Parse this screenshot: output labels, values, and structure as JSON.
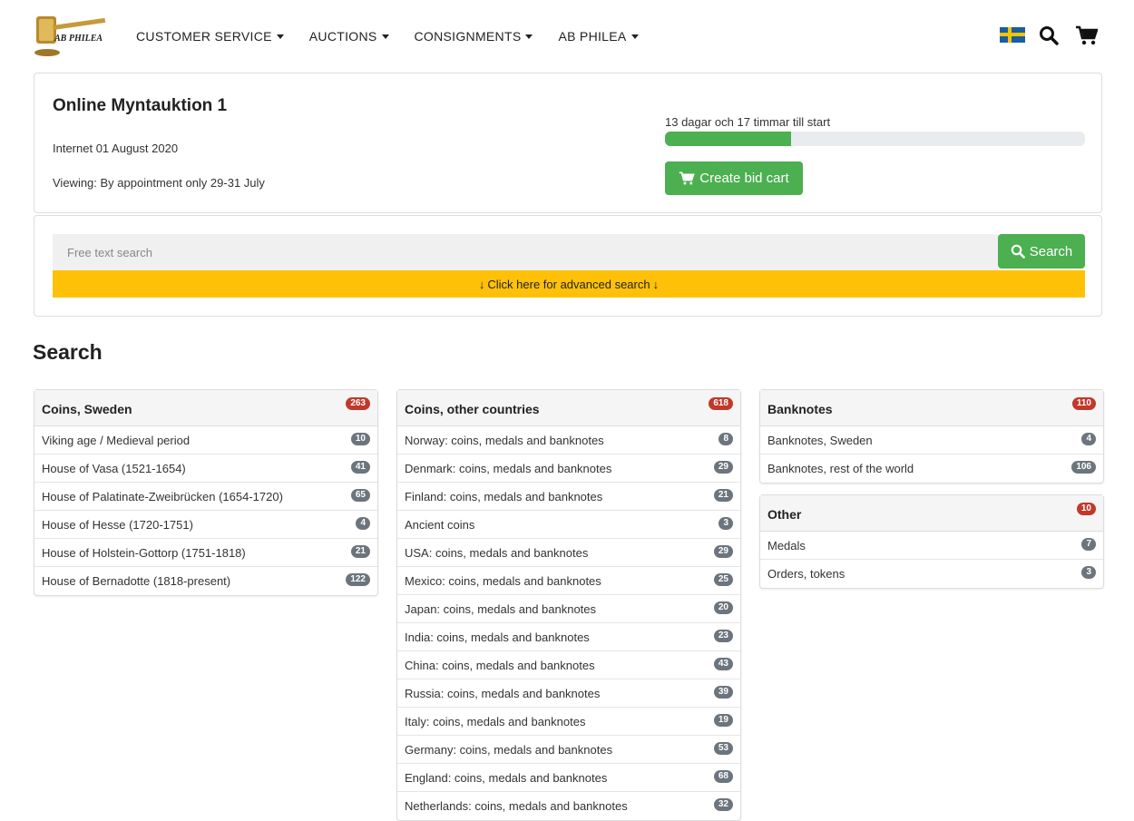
{
  "brand": {
    "logo_text": "AB PHILEA"
  },
  "nav": [
    {
      "label": "CUSTOMER SERVICE"
    },
    {
      "label": "AUCTIONS"
    },
    {
      "label": "CONSIGNMENTS"
    },
    {
      "label": "AB PHILEA"
    }
  ],
  "auction": {
    "title": "Online Myntauktion 1",
    "date": "Internet 01 August 2020",
    "viewing": "Viewing: By appointment only 29-31 July",
    "countdown": "13 dagar och 17 timmar till start",
    "progress_fraction": 0.3,
    "bid_cart_label": "Create bid cart"
  },
  "search": {
    "placeholder": "Free text search",
    "button_label": "Search",
    "advanced_label": "Click here for advanced search"
  },
  "section_title": "Search",
  "colors": {
    "green": "#4caf50",
    "yellow": "#ffc107",
    "badge_red": "#c0392b",
    "badge_gray": "#6c757d"
  },
  "categories": {
    "coins_sweden": {
      "title": "Coins, Sweden",
      "count": "263",
      "items": [
        {
          "label": "Viking age / Medieval period",
          "count": "10"
        },
        {
          "label": "House of Vasa (1521-1654)",
          "count": "41"
        },
        {
          "label": "House of Palatinate-Zweibrücken (1654-1720)",
          "count": "65"
        },
        {
          "label": "House of Hesse (1720-1751)",
          "count": "4"
        },
        {
          "label": "House of Holstein-Gottorp (1751-1818)",
          "count": "21"
        },
        {
          "label": "House of Bernadotte (1818-present)",
          "count": "122"
        }
      ]
    },
    "coins_other": {
      "title": "Coins, other countries",
      "count": "618",
      "items": [
        {
          "label": "Norway: coins, medals and banknotes",
          "count": "8"
        },
        {
          "label": "Denmark: coins, medals and banknotes",
          "count": "29"
        },
        {
          "label": "Finland: coins, medals and banknotes",
          "count": "21"
        },
        {
          "label": "Ancient coins",
          "count": "3"
        },
        {
          "label": "USA: coins, medals and banknotes",
          "count": "29"
        },
        {
          "label": "Mexico: coins, medals and banknotes",
          "count": "25"
        },
        {
          "label": "Japan: coins, medals and banknotes",
          "count": "20"
        },
        {
          "label": "India: coins, medals and banknotes",
          "count": "23"
        },
        {
          "label": "China: coins, medals and banknotes",
          "count": "43"
        },
        {
          "label": "Russia: coins, medals and banknotes",
          "count": "39"
        },
        {
          "label": "Italy: coins, medals and banknotes",
          "count": "19"
        },
        {
          "label": "Germany: coins, medals and banknotes",
          "count": "53"
        },
        {
          "label": "England: coins, medals and banknotes",
          "count": "68"
        },
        {
          "label": "Netherlands: coins, medals and banknotes",
          "count": "32"
        }
      ]
    },
    "banknotes": {
      "title": "Banknotes",
      "count": "110",
      "items": [
        {
          "label": "Banknotes, Sweden",
          "count": "4"
        },
        {
          "label": "Banknotes, rest of the world",
          "count": "106"
        }
      ]
    },
    "other": {
      "title": "Other",
      "count": "10",
      "items": [
        {
          "label": "Medals",
          "count": "7"
        },
        {
          "label": "Orders, tokens",
          "count": "3"
        }
      ]
    }
  }
}
